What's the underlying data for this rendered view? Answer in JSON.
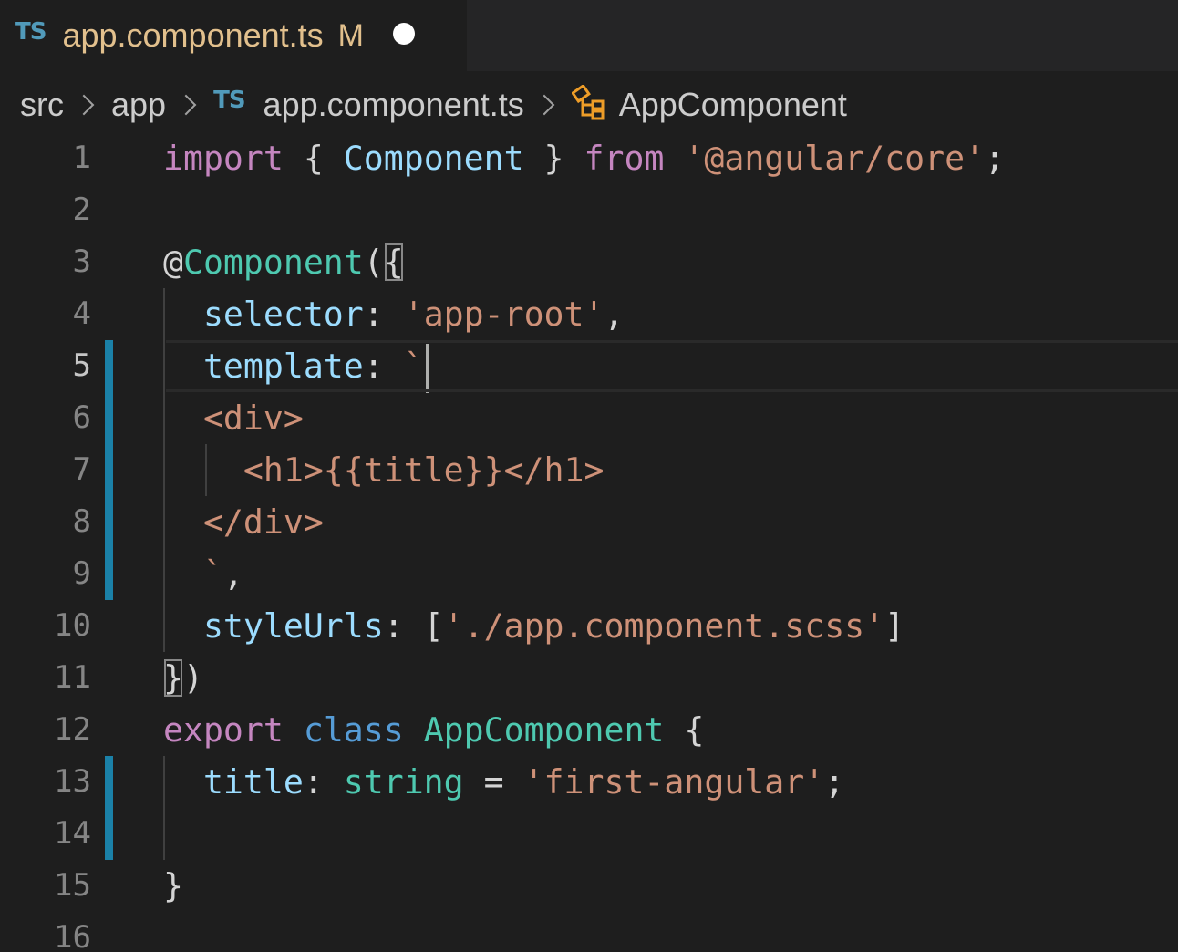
{
  "tab": {
    "badge": "TS",
    "filename": "app.component.ts",
    "status": "M"
  },
  "breadcrumb": {
    "items": [
      "src",
      "app",
      "app.component.ts",
      "AppComponent"
    ],
    "file_badge": "TS",
    "class_icon": "class-symbol-icon"
  },
  "colors": {
    "keyword": "#c586c0",
    "storage": "#569cd6",
    "type": "#4ec9b0",
    "property": "#9cdcfe",
    "string": "#ce9178",
    "modified_gutter": "#1b81a8",
    "tab_modified": "#e2c08d"
  },
  "editor": {
    "current_line": 5,
    "modified_lines": [
      5,
      6,
      7,
      8,
      9,
      13,
      14
    ],
    "line_numbers": [
      "1",
      "2",
      "3",
      "4",
      "5",
      "6",
      "7",
      "8",
      "9",
      "10",
      "11",
      "12",
      "13",
      "14",
      "15",
      "16"
    ],
    "code": {
      "l1": {
        "t1": "import",
        "t2": " { ",
        "t3": "Component",
        "t4": " } ",
        "t5": "from",
        "t6": " ",
        "t7": "'@angular/core'",
        "t8": ";"
      },
      "l3": {
        "t1": "@",
        "t2": "Component",
        "t3": "(",
        "t4": "{"
      },
      "l4": {
        "t1": "  ",
        "t2": "selector",
        "t3": ": ",
        "t4": "'app-root'",
        "t5": ","
      },
      "l5": {
        "t1": "  ",
        "t2": "template",
        "t3": ": ",
        "t4": "`"
      },
      "l6": {
        "t1": "  <div>"
      },
      "l7": {
        "t1": "    <h1>{{title}}</h1>"
      },
      "l8": {
        "t1": "  </div>"
      },
      "l9": {
        "t1": "  `",
        "t2": ","
      },
      "l10": {
        "t1": "  ",
        "t2": "styleUrls",
        "t3": ": [",
        "t4": "'./app.component.scss'",
        "t5": "]"
      },
      "l11": {
        "t1": "}",
        "t2": ")"
      },
      "l12": {
        "t1": "export",
        "t2": " ",
        "t3": "class",
        "t4": " ",
        "t5": "AppComponent",
        "t6": " {"
      },
      "l13": {
        "t1": "  ",
        "t2": "title",
        "t3": ": ",
        "t4": "string",
        "t5": " = ",
        "t6": "'first-angular'",
        "t7": ";"
      },
      "l15": {
        "t1": "}"
      }
    }
  }
}
